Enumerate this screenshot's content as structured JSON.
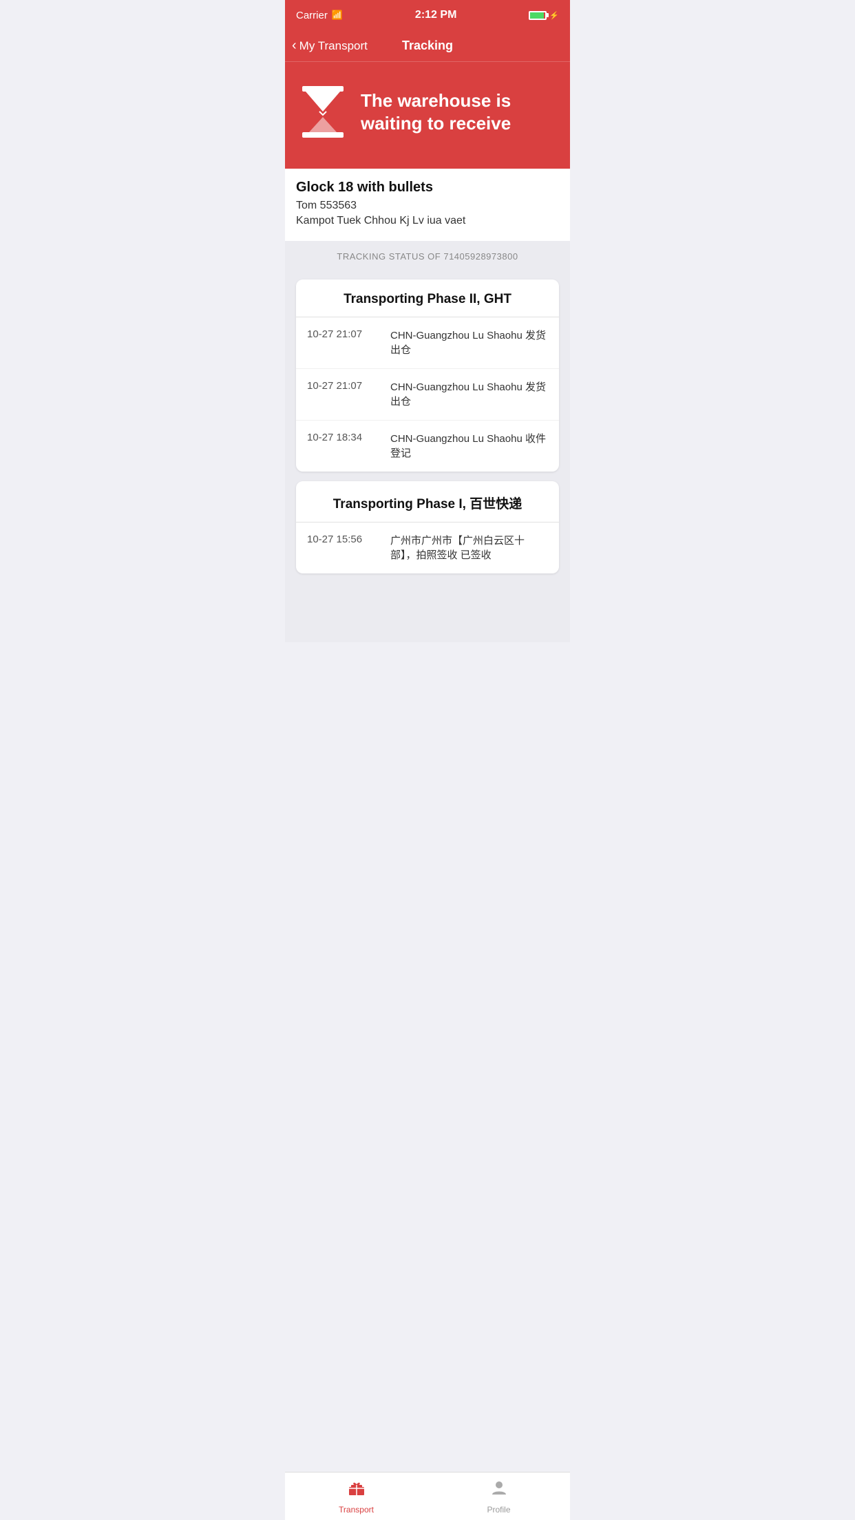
{
  "statusBar": {
    "carrier": "Carrier",
    "time": "2:12 PM"
  },
  "navBar": {
    "backLabel": "My Transport",
    "title": "Tracking"
  },
  "hero": {
    "statusText": "The warehouse is waiting to receive"
  },
  "package": {
    "name": "Glock 18 with bullets",
    "contact": "Tom 553563",
    "address": "Kampot Tuek Chhou Kj Lv iua vaet"
  },
  "trackingHeader": {
    "label": "TRACKING STATUS OF 71405928973800"
  },
  "trackingCards": [
    {
      "title": "Transporting Phase II, GHT",
      "rows": [
        {
          "time": "10-27 21:07",
          "desc": "CHN-Guangzhou Lu Shaohu 发货出仓"
        },
        {
          "time": "10-27 21:07",
          "desc": "CHN-Guangzhou Lu Shaohu 发货出仓"
        },
        {
          "time": "10-27 18:34",
          "desc": "CHN-Guangzhou Lu Shaohu 收件登记"
        }
      ]
    },
    {
      "title": "Transporting Phase I, 百世快递",
      "rows": [
        {
          "time": "10-27 15:56",
          "desc": "广州市广州市【广州白云区十部】，拍照签收 已签收"
        }
      ]
    }
  ],
  "tabBar": {
    "tabs": [
      {
        "id": "transport",
        "label": "Transport",
        "active": true
      },
      {
        "id": "profile",
        "label": "Profile",
        "active": false
      }
    ]
  }
}
